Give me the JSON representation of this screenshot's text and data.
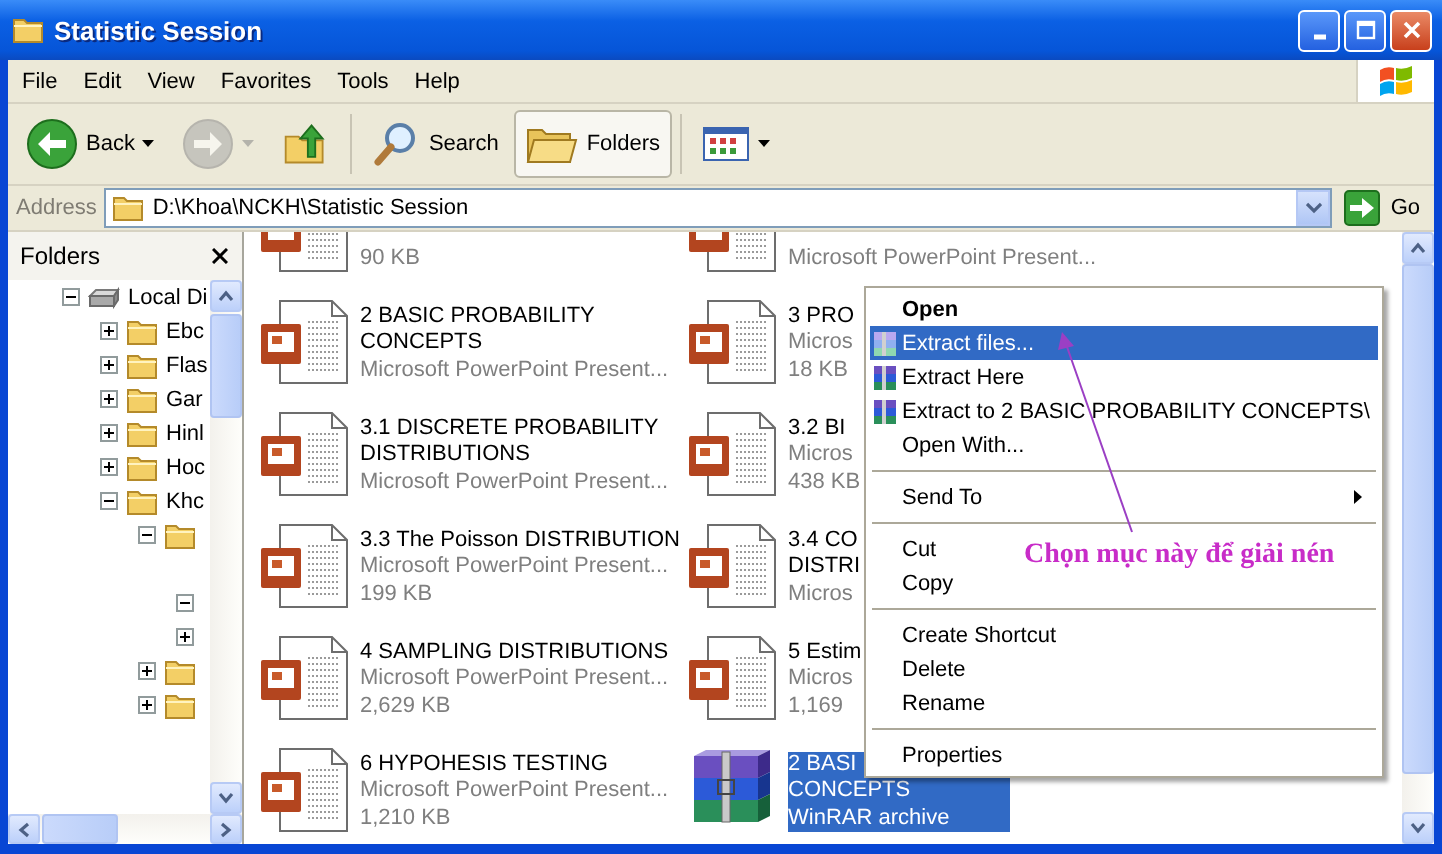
{
  "window": {
    "title": "Statistic Session"
  },
  "menu_bar": [
    "File",
    "Edit",
    "View",
    "Favorites",
    "Tools",
    "Help"
  ],
  "toolbar": {
    "back": "Back",
    "forward": {
      "disabled": true
    },
    "search": "Search",
    "folders": {
      "label": "Folders",
      "selected": true
    }
  },
  "address_bar": {
    "label": "Address",
    "value": "D:\\Khoa\\NCKH\\Statistic Session",
    "go": "Go"
  },
  "folders_pane": {
    "title": "Folders",
    "tree": [
      {
        "label": "Local Di",
        "kind": "drive",
        "expandable": true,
        "expanded": true,
        "children": [
          {
            "label": "Ebc",
            "kind": "folder",
            "expandable": true,
            "expanded": false
          },
          {
            "label": "Flas",
            "kind": "folder",
            "expandable": true,
            "expanded": false
          },
          {
            "label": "Gar",
            "kind": "folder",
            "expandable": true,
            "expanded": false
          },
          {
            "label": "Hinl",
            "kind": "folder",
            "expandable": true,
            "expanded": false
          },
          {
            "label": "Hoc",
            "kind": "folder",
            "expandable": true,
            "expanded": false
          },
          {
            "label": "Khc",
            "kind": "folder",
            "expandable": true,
            "expanded": true,
            "children": [
              {
                "kind": "folder",
                "expandable": true,
                "expanded": true,
                "children": [
                  {
                    "expandable": false
                  },
                  {
                    "expandable": true,
                    "expanded": true
                  },
                  {
                    "expandable": true,
                    "expanded": false
                  }
                ]
              },
              {
                "kind": "folder",
                "expandable": true,
                "expanded": false
              },
              {
                "kind": "folder",
                "expandable": true,
                "expanded": false
              }
            ]
          }
        ]
      }
    ]
  },
  "files": [
    {
      "kind": "ppt",
      "selected": false,
      "lines": [
        {
          "text": "90 KB",
          "kind": "detail"
        }
      ]
    },
    {
      "kind": "ppt",
      "selected": false,
      "lines": [
        {
          "text": "Microsoft PowerPoint Present...",
          "kind": "detail"
        }
      ]
    },
    {
      "kind": "ppt",
      "selected": false,
      "lines": [
        {
          "text": "2 BASIC PROBABILITY",
          "kind": "name"
        },
        {
          "text": "CONCEPTS",
          "kind": "name"
        },
        {
          "text": "Microsoft PowerPoint Present...",
          "kind": "detail"
        }
      ]
    },
    {
      "kind": "ppt",
      "selected": false,
      "lines": [
        {
          "text": "3 PRO",
          "kind": "name"
        },
        {
          "text": "Micros",
          "kind": "detail"
        },
        {
          "text": "18 KB",
          "kind": "detail"
        }
      ]
    },
    {
      "kind": "ppt",
      "selected": false,
      "lines": [
        {
          "text": "3.1 DISCRETE PROBABILITY",
          "kind": "name"
        },
        {
          "text": "DISTRIBUTIONS",
          "kind": "name"
        },
        {
          "text": "Microsoft PowerPoint Present...",
          "kind": "detail"
        }
      ]
    },
    {
      "kind": "ppt",
      "selected": false,
      "lines": [
        {
          "text": "3.2 BI",
          "kind": "name"
        },
        {
          "text": "Micros",
          "kind": "detail"
        },
        {
          "text": "438 KB",
          "kind": "detail"
        }
      ]
    },
    {
      "kind": "ppt",
      "selected": false,
      "lines": [
        {
          "text": "3.3 The Poisson DISTRIBUTION",
          "kind": "name"
        },
        {
          "text": "Microsoft PowerPoint Present...",
          "kind": "detail"
        },
        {
          "text": "199 KB",
          "kind": "detail"
        }
      ]
    },
    {
      "kind": "ppt",
      "selected": false,
      "lines": [
        {
          "text": "3.4 CO",
          "kind": "name"
        },
        {
          "text": "DISTRI",
          "kind": "name"
        },
        {
          "text": "Micros",
          "kind": "detail"
        }
      ]
    },
    {
      "kind": "ppt",
      "selected": false,
      "lines": [
        {
          "text": "4 SAMPLING DISTRIBUTIONS",
          "kind": "name"
        },
        {
          "text": "Microsoft PowerPoint Present...",
          "kind": "detail"
        },
        {
          "text": "2,629 KB",
          "kind": "detail"
        }
      ]
    },
    {
      "kind": "ppt",
      "selected": false,
      "lines": [
        {
          "text": "5 Estim",
          "kind": "name"
        },
        {
          "text": "Micros",
          "kind": "detail"
        },
        {
          "text": "1,169",
          "kind": "detail"
        }
      ]
    },
    {
      "kind": "ppt",
      "selected": false,
      "lines": [
        {
          "text": "6 HYPOHESIS TESTING",
          "kind": "name"
        },
        {
          "text": "Microsoft PowerPoint Present...",
          "kind": "detail"
        },
        {
          "text": "1,210 KB",
          "kind": "detail"
        }
      ]
    },
    {
      "kind": "rar",
      "selected": true,
      "lines": [
        {
          "text": "2 BASI",
          "kind": "name"
        },
        {
          "text": "CONCEPTS",
          "kind": "name"
        },
        {
          "text": "WinRAR archive",
          "kind": "detail"
        }
      ]
    }
  ],
  "context_menu": [
    {
      "kind": "item",
      "label": "Open",
      "default": true,
      "icon": false,
      "submenu": false,
      "selected": false
    },
    {
      "kind": "item",
      "label": "Extract files...",
      "default": false,
      "icon": true,
      "submenu": false,
      "selected": true
    },
    {
      "kind": "item",
      "label": "Extract Here",
      "default": false,
      "icon": true,
      "submenu": false,
      "selected": false
    },
    {
      "kind": "item",
      "label": "Extract to 2 BASIC PROBABILITY CONCEPTS\\",
      "default": false,
      "icon": true,
      "submenu": false,
      "selected": false
    },
    {
      "kind": "item",
      "label": "Open With...",
      "default": false,
      "icon": false,
      "submenu": false,
      "selected": false
    },
    {
      "kind": "separator"
    },
    {
      "kind": "item",
      "label": "Send To",
      "default": false,
      "icon": false,
      "submenu": true,
      "selected": false
    },
    {
      "kind": "separator"
    },
    {
      "kind": "item",
      "label": "Cut",
      "default": false,
      "icon": false,
      "submenu": false,
      "selected": false
    },
    {
      "kind": "item",
      "label": "Copy",
      "default": false,
      "icon": false,
      "submenu": false,
      "selected": false
    },
    {
      "kind": "separator"
    },
    {
      "kind": "item",
      "label": "Create Shortcut",
      "default": false,
      "icon": false,
      "submenu": false,
      "selected": false
    },
    {
      "kind": "item",
      "label": "Delete",
      "default": false,
      "icon": false,
      "submenu": false,
      "selected": false
    },
    {
      "kind": "item",
      "label": "Rename",
      "default": false,
      "icon": false,
      "submenu": false,
      "selected": false
    },
    {
      "kind": "separator"
    },
    {
      "kind": "item",
      "label": "Properties",
      "default": false,
      "icon": false,
      "submenu": false,
      "selected": false
    }
  ],
  "annotation": {
    "text": "Chọn mục này để giải nén"
  }
}
